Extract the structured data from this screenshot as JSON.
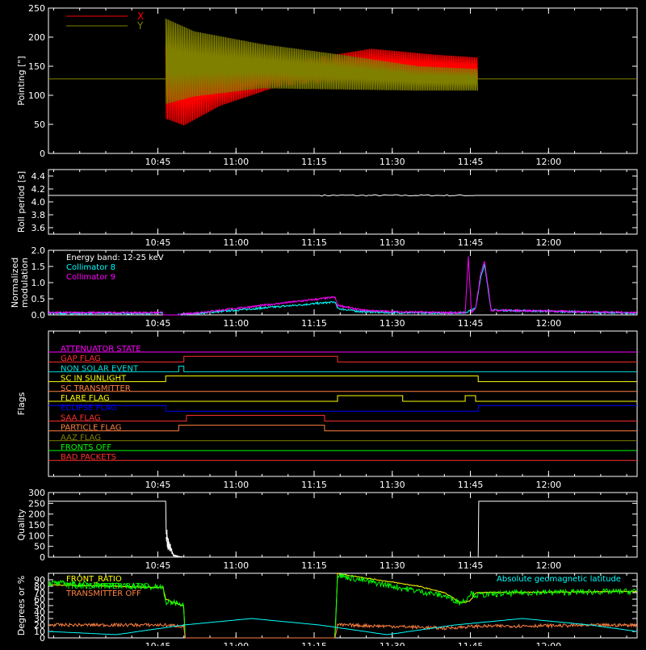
{
  "time_ticks": [
    "10:45",
    "11:00",
    "11:15",
    "11:30",
    "11:45",
    "12:00"
  ],
  "time_ticks_minutes": [
    645,
    660,
    675,
    690,
    705,
    720
  ],
  "time_range_minutes": [
    624,
    737
  ],
  "chart_data": [
    {
      "id": "pointing",
      "type": "line",
      "ylabel": "Pointing [\"]",
      "ylim": [
        0,
        250
      ],
      "yticks": [
        "0",
        "50",
        "100",
        "150",
        "200",
        "250"
      ],
      "legend": [
        {
          "name": "X",
          "color": "#ff0000"
        },
        {
          "name": "Y",
          "color": "#808000"
        }
      ],
      "baseline_value": 128,
      "series": [
        {
          "name": "X",
          "color": "#ff0000",
          "x_range": [
            646.5,
            706.5
          ],
          "envelope_top": [
            [
              646.5,
              185
            ],
            [
              651,
              155
            ],
            [
              660,
              150
            ],
            [
              672,
              160
            ],
            [
              686,
              180
            ],
            [
              698,
              170
            ],
            [
              706.5,
              165
            ]
          ],
          "envelope_bottom": [
            [
              646.5,
              60
            ],
            [
              650,
              48
            ],
            [
              657,
              82
            ],
            [
              668,
              115
            ],
            [
              680,
              125
            ],
            [
              695,
              128
            ],
            [
              706.5,
              128
            ]
          ]
        },
        {
          "name": "Y",
          "color": "#808000",
          "x_range": [
            646.5,
            706.5
          ],
          "envelope_top": [
            [
              646.5,
              232
            ],
            [
              652,
              210
            ],
            [
              665,
              188
            ],
            [
              680,
              170
            ],
            [
              695,
              150
            ],
            [
              706.5,
              145
            ]
          ],
          "envelope_bottom": [
            [
              646.5,
              85
            ],
            [
              652,
              98
            ],
            [
              665,
              112
            ],
            [
              680,
              110
            ],
            [
              695,
              108
            ],
            [
              706.5,
              108
            ]
          ]
        }
      ]
    },
    {
      "id": "roll",
      "type": "line",
      "ylabel": "Roll period [s]",
      "ylim": [
        3.5,
        4.5
      ],
      "yticks": [
        "3.6",
        "3.8",
        "4.0",
        "4.2",
        "4.4"
      ],
      "series": [
        {
          "name": "",
          "color": "#ffffff",
          "x": [
            624,
            737
          ],
          "y": [
            4.1,
            4.1
          ]
        }
      ]
    },
    {
      "id": "modulation",
      "type": "line",
      "ylabel": [
        "Normalized",
        "modulation"
      ],
      "ylim": [
        0,
        2.0
      ],
      "yticks": [
        "0.0",
        "0.5",
        "1.0",
        "1.5",
        "2.0"
      ],
      "annotations": [
        {
          "text": "Energy band: 12-25 keV",
          "color": "#ffffff"
        },
        {
          "text": "Collimator 8",
          "color": "#00ffff"
        },
        {
          "text": "Collimator 9",
          "color": "#ff00ff"
        }
      ],
      "series": [
        {
          "name": "Collimator 8",
          "color": "#00ffff",
          "x": [
            624,
            641,
            646,
            649,
            679,
            679.5,
            684,
            690,
            700,
            704,
            706,
            707,
            707.7,
            708.3,
            709,
            737
          ],
          "y": [
            0.05,
            0.05,
            0.05,
            0.0,
            0.4,
            0.2,
            0.1,
            0.07,
            0.06,
            0.07,
            0.2,
            1.2,
            1.55,
            0.9,
            0.15,
            0.05
          ]
        },
        {
          "name": "Collimator 9",
          "color": "#ff00ff",
          "x": [
            624,
            641,
            646,
            649,
            679,
            679.5,
            684,
            690,
            700,
            703,
            704,
            704.6,
            705.2,
            706,
            707,
            707.7,
            708.3,
            709,
            737
          ],
          "y": [
            0.07,
            0.07,
            0.07,
            0.0,
            0.55,
            0.3,
            0.15,
            0.1,
            0.07,
            0.07,
            0.07,
            1.8,
            0.07,
            0.2,
            1.3,
            1.65,
            1.0,
            0.15,
            0.07
          ]
        }
      ]
    },
    {
      "id": "flags",
      "type": "line",
      "ylabel": "Flags",
      "flags": [
        {
          "name": "ATTENUATOR STATE",
          "color": "#ff00ff",
          "steps": [
            [
              624,
              0
            ]
          ]
        },
        {
          "name": "GAP FLAG",
          "color": "#ff3030",
          "steps": [
            [
              624,
              0
            ],
            [
              650,
              1
            ],
            [
              679.5,
              0
            ]
          ]
        },
        {
          "name": "NON SOLAR EVENT",
          "color": "#00e0e0",
          "steps": [
            [
              624,
              0
            ],
            [
              649,
              1
            ],
            [
              650,
              0
            ]
          ]
        },
        {
          "name": "SC IN SUNLIGHT",
          "color": "#ffff00",
          "steps": [
            [
              624,
              0
            ],
            [
              646.5,
              1
            ],
            [
              706.5,
              0
            ]
          ]
        },
        {
          "name": "SC TRANSMITTER",
          "color": "#ff8040",
          "steps": [
            [
              624,
              0
            ]
          ]
        },
        {
          "name": "FLARE FLAG",
          "color": "#ffff00",
          "steps": [
            [
              624,
              0
            ],
            [
              679.5,
              1
            ],
            [
              692,
              0
            ],
            [
              704,
              1
            ],
            [
              706,
              0
            ]
          ]
        },
        {
          "name": "ECLIPSE FLAG",
          "color": "#0000ff",
          "steps": [
            [
              624,
              1
            ],
            [
              646.5,
              0
            ],
            [
              706.5,
              1
            ]
          ]
        },
        {
          "name": "SAA FLAG",
          "color": "#ff3030",
          "steps": [
            [
              624,
              0
            ],
            [
              650.5,
              1
            ],
            [
              677,
              0
            ]
          ]
        },
        {
          "name": "PARTICLE FLAG",
          "color": "#ff8040",
          "steps": [
            [
              624,
              0
            ],
            [
              649,
              1
            ],
            [
              677,
              0
            ]
          ]
        },
        {
          "name": "AAZ FLAG",
          "color": "#808000",
          "steps": [
            [
              624,
              0
            ]
          ]
        },
        {
          "name": "FRONTS OFF",
          "color": "#00ff00",
          "steps": [
            [
              624,
              0
            ]
          ]
        },
        {
          "name": "BAD PACKETS",
          "color": "#ff3030",
          "steps": [
            [
              624,
              0
            ]
          ]
        }
      ]
    },
    {
      "id": "quality",
      "type": "line",
      "ylabel": "Quality",
      "ylim": [
        0,
        300
      ],
      "yticks": [
        "0",
        "50",
        "100",
        "150",
        "200",
        "250",
        "300"
      ],
      "series": [
        {
          "name": "",
          "color": "#ffffff",
          "x": [
            624,
            646.5,
            646.6,
            647.5,
            648,
            649,
            650,
            706.5,
            706.6,
            737
          ],
          "y": [
            260,
            260,
            110,
            40,
            10,
            3,
            0,
            0,
            260,
            260
          ]
        }
      ]
    },
    {
      "id": "front",
      "type": "line",
      "ylabel": "Degrees or %",
      "ylim": [
        0,
        100
      ],
      "yticks": [
        "0",
        "10",
        "20",
        "30",
        "40",
        "50",
        "60",
        "70",
        "80",
        "90"
      ],
      "annotations": [
        {
          "text": "FRONT_RATIO",
          "color": "#ffff00"
        },
        {
          "text": "TRANSMITTER RATIO",
          "color": "#00ff00"
        },
        {
          "text": "TRANSMITTER OFF",
          "color": "#ff8040"
        },
        {
          "text": "Absolute geomagnetic latitude",
          "color": "#00ffff"
        }
      ],
      "series": [
        {
          "name": "FRONT_RATIO",
          "color": "#ffff00",
          "x": [
            624,
            646,
            646.5,
            649,
            650,
            650.2,
            679,
            679.5,
            680,
            695,
            700,
            703,
            704,
            705,
            706,
            737
          ],
          "y": [
            82,
            78,
            60,
            52,
            50,
            0,
            0,
            100,
            99,
            80,
            70,
            55,
            55,
            58,
            70,
            72
          ]
        },
        {
          "name": "TRANSMITTER RATIO",
          "color": "#00ff00",
          "x": [
            624,
            634,
            640,
            646,
            646.5,
            649,
            650,
            650.2,
            679,
            679.5,
            680,
            690,
            700,
            703,
            704,
            705,
            706,
            715,
            737
          ],
          "y": [
            85,
            82,
            80,
            78,
            55,
            55,
            50,
            0,
            0,
            98,
            96,
            80,
            65,
            55,
            58,
            70,
            66,
            70,
            72
          ]
        },
        {
          "name": "TRANSMITTER OFF",
          "color": "#ff8040",
          "x": [
            624,
            646,
            650,
            650.2,
            679,
            679.5,
            690,
            700,
            706,
            737
          ],
          "y": [
            20,
            20,
            18,
            0,
            0,
            20,
            18,
            15,
            18,
            20
          ]
        },
        {
          "name": "Absolute geomagnetic latitude",
          "color": "#00ffff",
          "x": [
            624,
            637,
            650,
            663,
            676,
            689,
            702,
            715,
            728,
            737
          ],
          "y": [
            10,
            5,
            20,
            30,
            20,
            5,
            20,
            30,
            20,
            10
          ]
        }
      ]
    }
  ]
}
